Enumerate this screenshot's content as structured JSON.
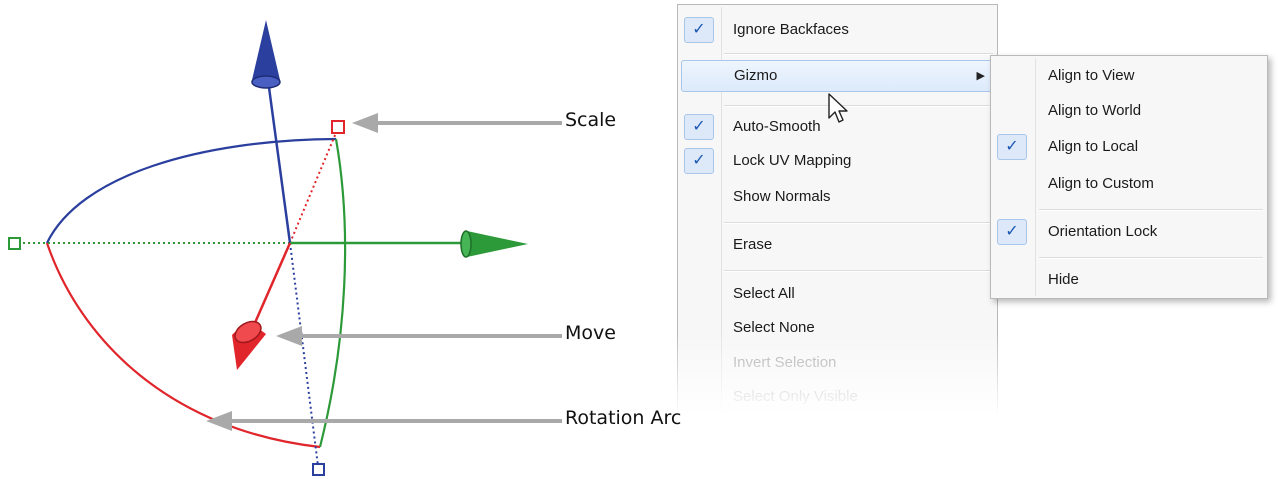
{
  "callouts": {
    "scale": "Scale",
    "move": "Move",
    "rotation_arc": "Rotation Arc"
  },
  "axis_colors": {
    "x": "#e0252b",
    "y": "#2d9a3a",
    "z": "#2b3f9e",
    "callout_arrow": "#a9a9a9"
  },
  "main_menu": {
    "items": [
      {
        "label": "Ignore Backfaces",
        "checked": true
      },
      {
        "label": "Gizmo",
        "submenu": true,
        "highlighted": true
      },
      {
        "label": "Auto-Smooth",
        "checked": true
      },
      {
        "label": "Lock UV Mapping",
        "checked": true
      },
      {
        "label": "Show Normals",
        "checked": false
      },
      {
        "label": "Erase"
      },
      {
        "label": "Select All"
      },
      {
        "label": "Select None"
      },
      {
        "label": "Invert Selection",
        "disabled": true
      },
      {
        "label": "Select Only Visible",
        "disabled": true
      }
    ]
  },
  "gizmo_submenu": {
    "items": [
      {
        "label": "Align to View",
        "checked": false
      },
      {
        "label": "Align to World",
        "checked": false
      },
      {
        "label": "Align to Local",
        "checked": true
      },
      {
        "label": "Align to Custom",
        "checked": false
      },
      {
        "label": "Orientation Lock",
        "checked": true
      },
      {
        "label": "Hide"
      }
    ]
  },
  "icons": {
    "check": "✓",
    "submenu_arrow": "▶",
    "cursor": "mouse-pointer-icon"
  }
}
